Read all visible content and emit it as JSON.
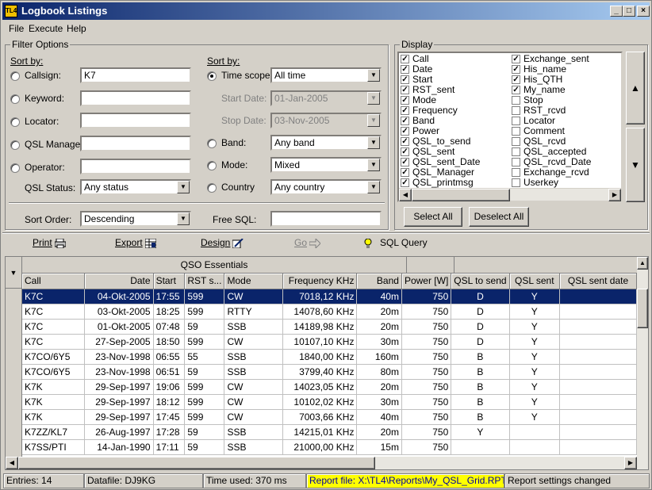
{
  "window": {
    "title": "Logbook Listings",
    "app_icon_text": "TL4"
  },
  "menu": [
    "File",
    "Execute",
    "Help"
  ],
  "filter": {
    "group_label": "Filter Options",
    "sort_by_left": "Sort by:",
    "sort_by_right": "Sort by:",
    "callsign_label": "Callsign:",
    "callsign_value": "K7",
    "keyword_label": "Keyword:",
    "locator_label": "Locator:",
    "qsl_manager_label": "QSL Manager:",
    "operator_label": "Operator:",
    "qsl_status_label": "QSL Status:",
    "qsl_status_value": "Any status",
    "time_scope_label": "Time scope:",
    "time_scope_value": "All time",
    "start_date_label": "Start Date:",
    "start_date_value": "01-Jan-2005",
    "stop_date_label": "Stop Date:",
    "stop_date_value": "03-Nov-2005",
    "band_label": "Band:",
    "band_value": "Any band",
    "mode_label": "Mode:",
    "mode_value": "Mixed",
    "country_label": "Country",
    "country_value": "Any country",
    "sort_order_label": "Sort Order:",
    "sort_order_value": "Descending",
    "free_sql_label": "Free SQL:"
  },
  "display": {
    "group_label": "Display",
    "col1": [
      {
        "label": "Call",
        "checked": true
      },
      {
        "label": "Date",
        "checked": true
      },
      {
        "label": "Start",
        "checked": true
      },
      {
        "label": "RST_sent",
        "checked": true
      },
      {
        "label": "Mode",
        "checked": true
      },
      {
        "label": "Frequency",
        "checked": true
      },
      {
        "label": "Band",
        "checked": true
      },
      {
        "label": "Power",
        "checked": true
      },
      {
        "label": "QSL_to_send",
        "checked": true
      },
      {
        "label": "QSL_sent",
        "checked": true
      },
      {
        "label": "QSL_sent_Date",
        "checked": true
      },
      {
        "label": "QSL_Manager",
        "checked": true
      },
      {
        "label": "QSL_printmsg",
        "checked": true
      }
    ],
    "col2": [
      {
        "label": "Exchange_sent",
        "checked": true
      },
      {
        "label": "His_name",
        "checked": true
      },
      {
        "label": "His_QTH",
        "checked": true
      },
      {
        "label": "My_name",
        "checked": true
      },
      {
        "label": "Stop",
        "checked": false
      },
      {
        "label": "RST_rcvd",
        "checked": false
      },
      {
        "label": "Locator",
        "checked": false
      },
      {
        "label": "Comment",
        "checked": false
      },
      {
        "label": "QSL_rcvd",
        "checked": false
      },
      {
        "label": "QSL_accepted",
        "checked": false
      },
      {
        "label": "QSL_rcvd_Date",
        "checked": false
      },
      {
        "label": "Exchange_rcvd",
        "checked": false
      },
      {
        "label": "Userkey",
        "checked": false
      }
    ],
    "select_all": "Select All",
    "deselect_all": "Deselect All"
  },
  "toolbar": {
    "print": "Print",
    "export": "Export",
    "design": "Design",
    "go": "Go",
    "sql_query": "SQL Query"
  },
  "grid": {
    "group_header": "QSO Essentials",
    "columns": [
      "Call",
      "Date",
      "Start",
      "RST s...",
      "Mode",
      "Frequency KHz",
      "Band",
      "Power [W]",
      "QSL to send",
      "QSL sent",
      "QSL sent date"
    ],
    "rows": [
      [
        "K7C",
        "04-Okt-2005",
        "17:55",
        "599",
        "CW",
        "7018,12 KHz",
        "40m",
        "750",
        "D",
        "Y",
        ""
      ],
      [
        "K7C",
        "03-Okt-2005",
        "18:25",
        "599",
        "RTTY",
        "14078,60 KHz",
        "20m",
        "750",
        "D",
        "Y",
        ""
      ],
      [
        "K7C",
        "01-Okt-2005",
        "07:48",
        "59",
        "SSB",
        "14189,98 KHz",
        "20m",
        "750",
        "D",
        "Y",
        ""
      ],
      [
        "K7C",
        "27-Sep-2005",
        "18:50",
        "599",
        "CW",
        "10107,10 KHz",
        "30m",
        "750",
        "D",
        "Y",
        ""
      ],
      [
        "K7CO/6Y5",
        "23-Nov-1998",
        "06:55",
        "55",
        "SSB",
        "1840,00 KHz",
        "160m",
        "750",
        "B",
        "Y",
        ""
      ],
      [
        "K7CO/6Y5",
        "23-Nov-1998",
        "06:51",
        "59",
        "SSB",
        "3799,40 KHz",
        "80m",
        "750",
        "B",
        "Y",
        ""
      ],
      [
        "K7K",
        "29-Sep-1997",
        "19:06",
        "599",
        "CW",
        "14023,05 KHz",
        "20m",
        "750",
        "B",
        "Y",
        ""
      ],
      [
        "K7K",
        "29-Sep-1997",
        "18:12",
        "599",
        "CW",
        "10102,02 KHz",
        "30m",
        "750",
        "B",
        "Y",
        ""
      ],
      [
        "K7K",
        "29-Sep-1997",
        "17:45",
        "599",
        "CW",
        "7003,66 KHz",
        "40m",
        "750",
        "B",
        "Y",
        ""
      ],
      [
        "K7ZZ/KL7",
        "26-Aug-1997",
        "17:28",
        "59",
        "SSB",
        "14215,01 KHz",
        "20m",
        "750",
        "Y",
        "",
        ""
      ],
      [
        "K7SS/PTI",
        "14-Jan-1990",
        "17:11",
        "59",
        "SSB",
        "21000,00 KHz",
        "15m",
        "750",
        "",
        "",
        ""
      ]
    ]
  },
  "status": {
    "entries": "Entries: 14",
    "datafile": "Datafile: DJ9KG",
    "time_used": "Time used: 370 ms",
    "report_file": "Report file: X:\\TL4\\Reports\\My_QSL_Grid.RPT",
    "report_settings": "Report settings changed"
  }
}
